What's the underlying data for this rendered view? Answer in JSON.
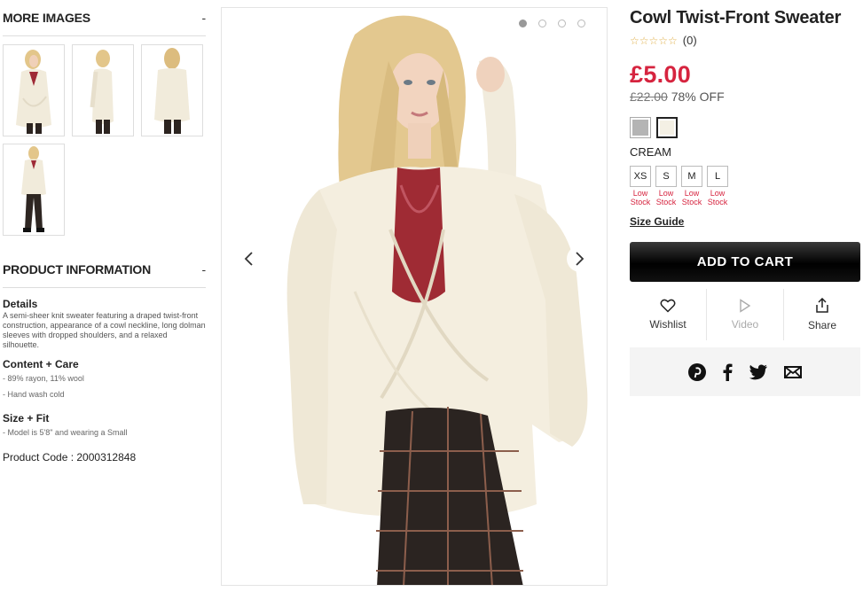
{
  "more_images": {
    "title": "MORE IMAGES",
    "toggle": "-"
  },
  "product_info": {
    "title": "PRODUCT INFORMATION",
    "toggle": "-",
    "details_heading": "Details",
    "details_text": "A semi-sheer knit sweater featuring a draped twist-front construction, appearance of a cowl neckline, long dolman sleeves with dropped shoulders, and a relaxed silhouette.",
    "content_heading": "Content + Care",
    "content_items": [
      "- 89% rayon, 11% wool",
      "- Hand wash cold"
    ],
    "size_heading": "Size + Fit",
    "size_items": [
      "- Model is 5'8\" and wearing a Small"
    ],
    "product_code": "Product Code : 2000312848"
  },
  "gallery": {
    "prev_icon": "chevron-left-icon",
    "next_icon": "chevron-right-icon",
    "dots": 4,
    "active_dot": 0
  },
  "product": {
    "title": "Cowl Twist-Front Sweater",
    "stars": "☆☆☆☆☆",
    "review_count": "(0)",
    "price": "£5.00",
    "original_price": "£22.00",
    "discount": "78% OFF",
    "swatches": [
      {
        "name": "heather-grey",
        "color": "#b4b4b4",
        "selected": false
      },
      {
        "name": "cream",
        "color": "#f4f0e4",
        "selected": true
      }
    ],
    "color_label": "CREAM",
    "sizes": [
      {
        "label": "XS",
        "stock1": "Low",
        "stock2": "Stock"
      },
      {
        "label": "S",
        "stock1": "Low",
        "stock2": "Stock"
      },
      {
        "label": "M",
        "stock1": "Low",
        "stock2": "Stock"
      },
      {
        "label": "L",
        "stock1": "Low",
        "stock2": "Stock"
      }
    ],
    "size_guide": "Size Guide",
    "add_to_cart": "ADD TO CART",
    "actions": {
      "wishlist": "Wishlist",
      "video": "Video",
      "share": "Share"
    }
  },
  "colors": {
    "price_red": "#d6243f",
    "button_black": "#000000",
    "star_gold": "#e0b04a"
  }
}
